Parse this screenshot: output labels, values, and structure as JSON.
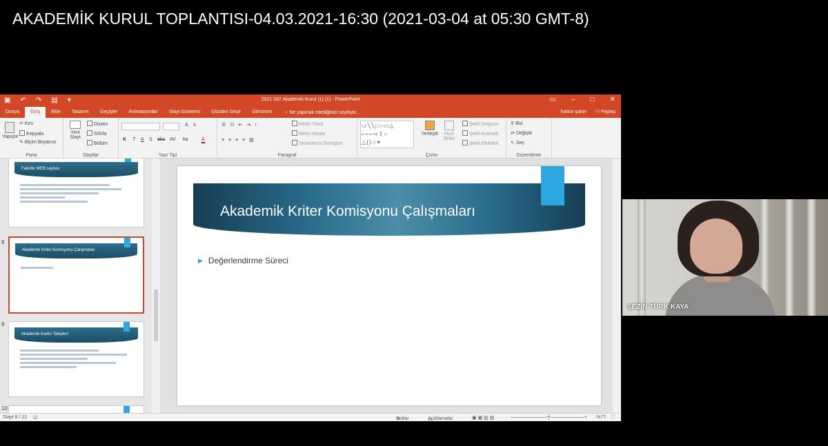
{
  "meeting": {
    "title": "AKADEMİK KURUL TOPLANTISI-04.03.2021-16:30 (2021-03-04 at 05:30 GMT-8)"
  },
  "powerpoint": {
    "window_title": "2021 037 Akademik Kurul (1) (1) - PowerPoint",
    "qat_icons": [
      "save-icon",
      "undo-icon",
      "redo-icon",
      "present-icon"
    ],
    "tabs": [
      "Dosya",
      "Giriş",
      "Ekle",
      "Tasarım",
      "Geçişler",
      "Animasyonlar",
      "Slayt Gösterisi",
      "Gözden Geçir",
      "Görünüm"
    ],
    "active_tab": "Giriş",
    "tell_me": "Ne yapmak istediğinizi söyleyin...",
    "user": "hatice şahin",
    "share": "Paylaş",
    "ribbon": {
      "clipboard": {
        "paste": "Yapıştır",
        "cut": "Kes",
        "copy": "Kopyala",
        "format_painter": "Biçim Boyacısı",
        "label": "Pano"
      },
      "slides": {
        "new_slide": "Yeni Slayt",
        "layout": "Düzen",
        "reset": "Sıfırla",
        "section": "Bölüm",
        "label": "Slaytlar"
      },
      "font": {
        "bold": "K",
        "italic": "T",
        "underline": "A",
        "strike": "S",
        "shadow": "abc",
        "spacing": "AV",
        "case": "Aa",
        "color": "A",
        "grow": "A",
        "shrink": "A",
        "label": "Yazı Tipi"
      },
      "paragraph": {
        "text_direction": "Metin Yönü",
        "align_text": "Metni Hizala",
        "smartart": "SmartArt'a Dönüştür",
        "label": "Paragraf"
      },
      "drawing": {
        "arrange": "Yerleştir",
        "quick_styles": "Hızlı Stiller",
        "shape_fill": "Şekil Dolgusu",
        "shape_outline": "Şekil Anahattı",
        "shape_effects": "Şekil Efektleri",
        "label": "Çizim"
      },
      "editing": {
        "find": "Bul",
        "replace": "Değiştir",
        "select": "Seç",
        "label": "Düzenleme"
      }
    },
    "thumbnails": [
      {
        "number": "",
        "title": "Fakülte WEB sayfası"
      },
      {
        "number": "8",
        "title": "Akademik Kriter Komisyonu Çalışmaları"
      },
      {
        "number": "9",
        "title": "Akademik Kadro Talepleri"
      },
      {
        "number": "10",
        "title": ""
      }
    ],
    "current_slide": {
      "title": "Akademik Kriter Komisyonu Çalışmaları",
      "bullet": "Değerlendirme Süreci"
    },
    "status": {
      "slide_position": "Slayt 8 / 12",
      "notes": "Notlar",
      "comments": "Açıklamalar",
      "zoom": "%77"
    },
    "colors": {
      "accent": "#d24726",
      "slide_banner": "#2a6d8c",
      "slide_accent": "#2ea6e0"
    }
  },
  "participant": {
    "name": "ŞEZİN TÜRK KAYA"
  }
}
